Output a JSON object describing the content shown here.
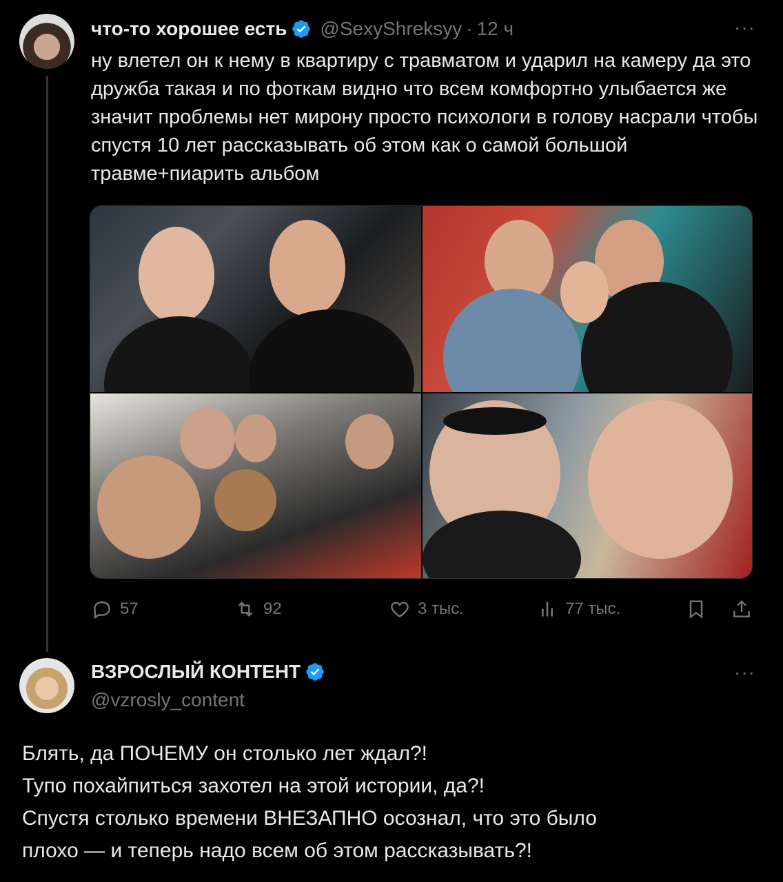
{
  "tweet1": {
    "author_name": "что-то хорошее есть",
    "handle": "@SexyShreksyy",
    "separator": "·",
    "time": "12 ч",
    "more": "···",
    "text": "ну влетел он к нему в квартиру с травматом и ударил на камеру да это дружба такая и по фоткам видно что всем комфортно улыбается же значит проблемы нет мирону просто психологи в голову насрали чтобы спустя 10 лет рассказывать об этом как о самой большой травме+пиарить альбом",
    "actions": {
      "replies": "57",
      "retweets": "92",
      "likes": "3 тыс.",
      "views": "77 тыс."
    }
  },
  "tweet2": {
    "author_name": "ВЗРОСЛЫЙ КОНТЕНТ",
    "handle": "@vzrosly_content",
    "more": "···",
    "lines": [
      "Блять, да ПОЧЕМУ он столько лет ждал?!",
      "Тупо похайпиться захотел на этой истории, да?!",
      "Спустя столько времени ВНЕЗАПНО осознал, что это было",
      "плохо — и теперь надо всем об этом рассказывать?!"
    ]
  },
  "colors": {
    "background": "#000000",
    "text": "#e7e9ea",
    "muted": "#71767b",
    "verified": "#1d9bf0"
  }
}
